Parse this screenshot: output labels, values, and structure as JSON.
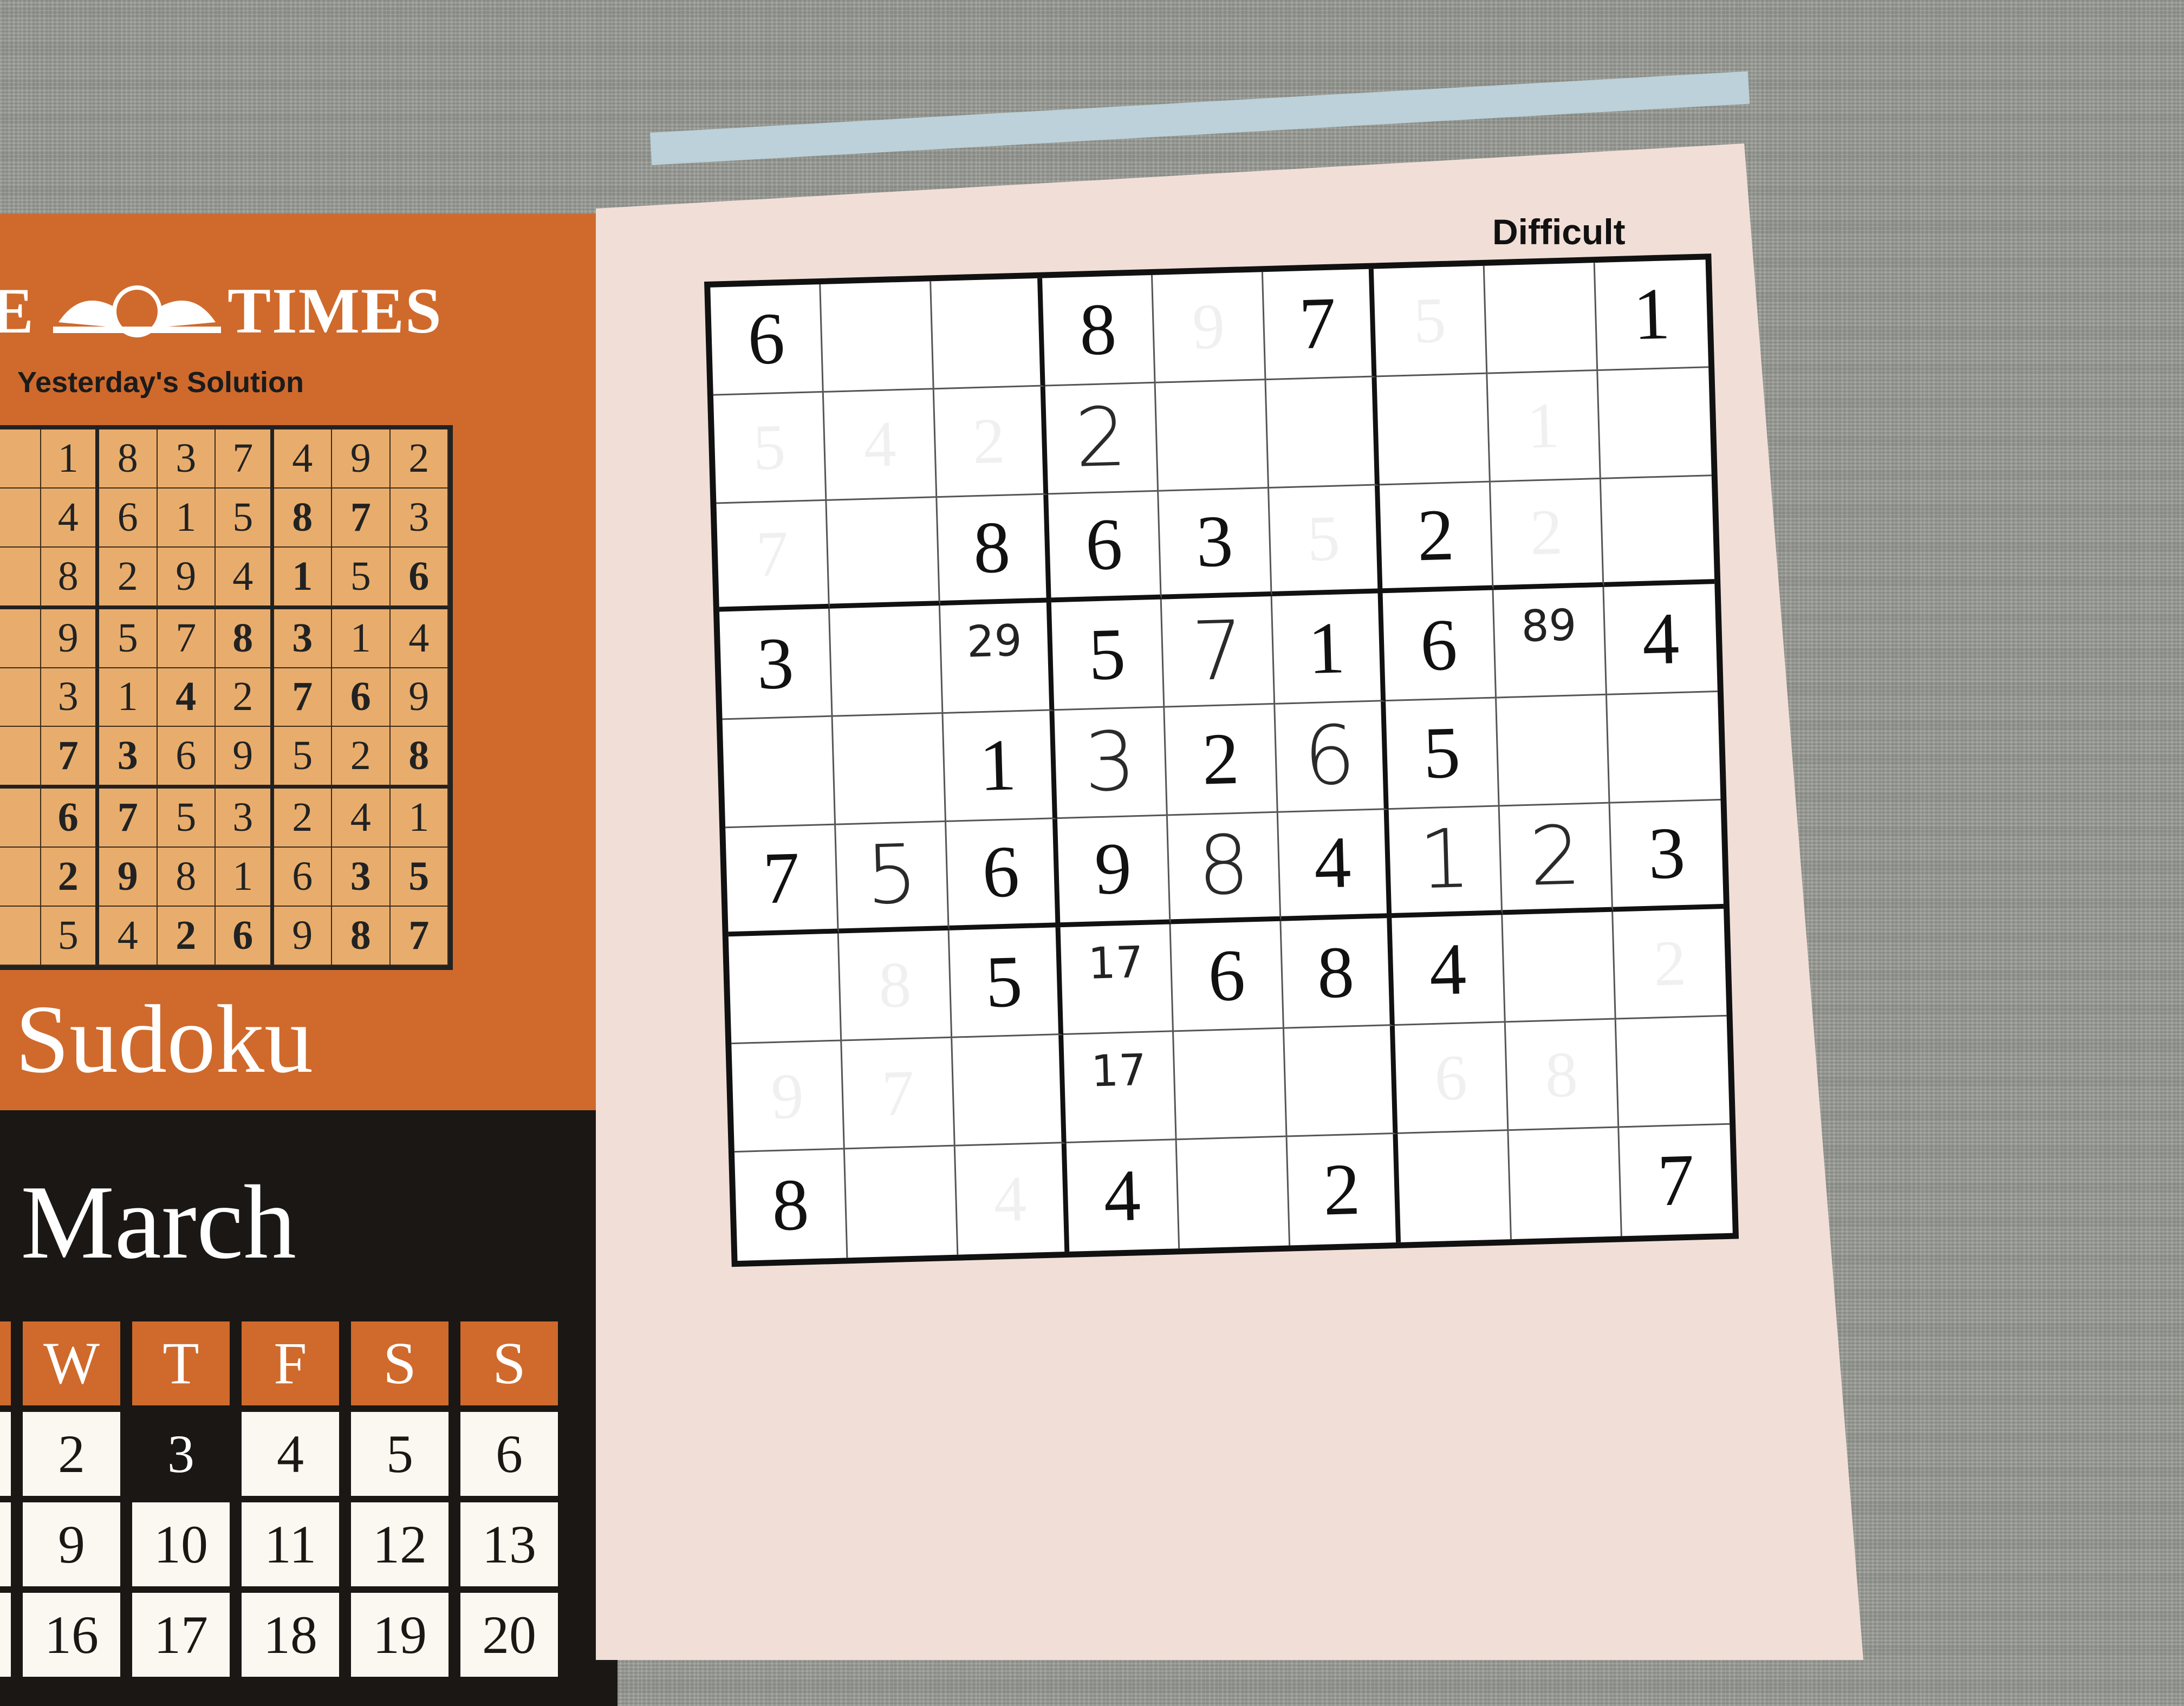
{
  "left_page": {
    "brand_left": "E",
    "brand_right": "TIMES",
    "solution_label": "Yesterday's Solution",
    "solution_rows": [
      [
        "",
        "1",
        "8",
        "3",
        "7",
        "4",
        "9",
        "2"
      ],
      [
        "",
        "4",
        "6",
        "1",
        "5",
        "8",
        "7",
        "3"
      ],
      [
        "",
        "8",
        "2",
        "9",
        "4",
        "1",
        "5",
        "6"
      ],
      [
        "",
        "9",
        "5",
        "7",
        "8",
        "3",
        "1",
        "4"
      ],
      [
        "",
        "3",
        "1",
        "4",
        "2",
        "7",
        "6",
        "9"
      ],
      [
        "",
        "7",
        "3",
        "6",
        "9",
        "5",
        "2",
        "8"
      ],
      [
        "",
        "6",
        "7",
        "5",
        "3",
        "2",
        "4",
        "1"
      ],
      [
        "",
        "2",
        "9",
        "8",
        "1",
        "6",
        "3",
        "5"
      ],
      [
        "",
        "5",
        "4",
        "2",
        "6",
        "9",
        "8",
        "7"
      ]
    ],
    "solution_bold": [
      [
        2,
        7
      ],
      [
        4,
        6
      ],
      [
        4,
        3
      ],
      [
        4,
        5
      ],
      [
        8,
        3
      ],
      [
        8,
        4
      ],
      [
        8,
        6
      ],
      [
        1,
        5
      ],
      [
        2,
        5
      ],
      [
        1,
        6
      ],
      [
        7,
        6
      ],
      [
        7,
        1
      ],
      [
        6,
        1
      ],
      [
        6,
        2
      ],
      [
        7,
        2
      ],
      [
        5,
        1
      ],
      [
        5,
        2
      ],
      [
        5,
        7
      ],
      [
        3,
        4
      ],
      [
        3,
        5
      ],
      [
        8,
        7
      ],
      [
        7,
        7
      ]
    ],
    "puzzle_name": "Sudoku",
    "month": "March",
    "calendar_headers": [
      "",
      "W",
      "T",
      "F",
      "S",
      "S"
    ],
    "calendar_rows": [
      [
        "",
        "2",
        "3",
        "4",
        "5",
        "6"
      ],
      [
        "",
        "9",
        "10",
        "11",
        "12",
        "13"
      ],
      [
        "",
        "16",
        "17",
        "18",
        "19",
        "20"
      ]
    ],
    "calendar_today": "3"
  },
  "right_page": {
    "difficulty": "Difficult",
    "grid": [
      [
        {
          "v": "6",
          "t": "given"
        },
        {
          "v": "",
          "t": ""
        },
        {
          "v": "",
          "t": ""
        },
        {
          "v": "8",
          "t": "given"
        },
        {
          "v": "9",
          "t": "erased"
        },
        {
          "v": "7",
          "t": "given"
        },
        {
          "v": "5",
          "t": "erased"
        },
        {
          "v": "",
          "t": ""
        },
        {
          "v": "1",
          "t": "given"
        }
      ],
      [
        {
          "v": "5",
          "t": "erased"
        },
        {
          "v": "4",
          "t": "erased"
        },
        {
          "v": "2",
          "t": "erased"
        },
        {
          "v": "2",
          "t": "pen"
        },
        {
          "v": "",
          "t": ""
        },
        {
          "v": "",
          "t": ""
        },
        {
          "v": "",
          "t": ""
        },
        {
          "v": "1",
          "t": "erased"
        },
        {
          "v": "",
          "t": ""
        }
      ],
      [
        {
          "v": "7",
          "t": "erased"
        },
        {
          "v": "",
          "t": ""
        },
        {
          "v": "8",
          "t": "given"
        },
        {
          "v": "6",
          "t": "given"
        },
        {
          "v": "3",
          "t": "given"
        },
        {
          "v": "5",
          "t": "erased"
        },
        {
          "v": "2",
          "t": "given"
        },
        {
          "v": "2",
          "t": "erased"
        },
        {
          "v": "",
          "t": ""
        }
      ],
      [
        {
          "v": "3",
          "t": "given"
        },
        {
          "v": "",
          "t": ""
        },
        {
          "v": "29",
          "t": "note"
        },
        {
          "v": "5",
          "t": "given"
        },
        {
          "v": "7",
          "t": "pen"
        },
        {
          "v": "1",
          "t": "given"
        },
        {
          "v": "6",
          "t": "given"
        },
        {
          "v": "89",
          "t": "note"
        },
        {
          "v": "4",
          "t": "given"
        }
      ],
      [
        {
          "v": "",
          "t": ""
        },
        {
          "v": "",
          "t": ""
        },
        {
          "v": "1",
          "t": "given"
        },
        {
          "v": "3",
          "t": "pen"
        },
        {
          "v": "2",
          "t": "given"
        },
        {
          "v": "6",
          "t": "pen"
        },
        {
          "v": "5",
          "t": "given"
        },
        {
          "v": "",
          "t": ""
        },
        {
          "v": "",
          "t": ""
        }
      ],
      [
        {
          "v": "7",
          "t": "given"
        },
        {
          "v": "5",
          "t": "pen"
        },
        {
          "v": "6",
          "t": "given"
        },
        {
          "v": "9",
          "t": "given"
        },
        {
          "v": "8",
          "t": "pen"
        },
        {
          "v": "4",
          "t": "given"
        },
        {
          "v": "1",
          "t": "pen"
        },
        {
          "v": "2",
          "t": "pen"
        },
        {
          "v": "3",
          "t": "given"
        }
      ],
      [
        {
          "v": "",
          "t": ""
        },
        {
          "v": "8",
          "t": "erased"
        },
        {
          "v": "5",
          "t": "given"
        },
        {
          "v": "17",
          "t": "note"
        },
        {
          "v": "6",
          "t": "given"
        },
        {
          "v": "8",
          "t": "given"
        },
        {
          "v": "4",
          "t": "given"
        },
        {
          "v": "",
          "t": ""
        },
        {
          "v": "2",
          "t": "erased"
        }
      ],
      [
        {
          "v": "9",
          "t": "erased"
        },
        {
          "v": "7",
          "t": "erased"
        },
        {
          "v": "",
          "t": ""
        },
        {
          "v": "17",
          "t": "note"
        },
        {
          "v": "",
          "t": ""
        },
        {
          "v": "",
          "t": ""
        },
        {
          "v": "6",
          "t": "erased"
        },
        {
          "v": "8",
          "t": "erased"
        },
        {
          "v": "",
          "t": ""
        }
      ],
      [
        {
          "v": "8",
          "t": "given"
        },
        {
          "v": "",
          "t": ""
        },
        {
          "v": "4",
          "t": "erased"
        },
        {
          "v": "4",
          "t": "given"
        },
        {
          "v": "",
          "t": ""
        },
        {
          "v": "2",
          "t": "given"
        },
        {
          "v": "",
          "t": ""
        },
        {
          "v": "",
          "t": ""
        },
        {
          "v": "7",
          "t": "given"
        }
      ]
    ]
  }
}
